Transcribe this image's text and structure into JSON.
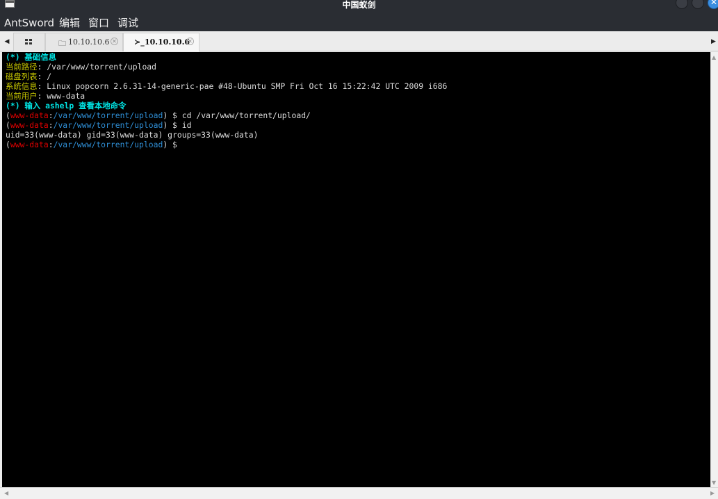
{
  "window": {
    "title": "中国蚁剑",
    "close_glyph": "✕"
  },
  "menu": {
    "items": [
      "AntSword",
      "编辑",
      "窗口",
      "调试"
    ]
  },
  "tabs": {
    "scroll_left": "◀",
    "scroll_right": "▶",
    "items": [
      {
        "icon": "folder-icon",
        "icon_glyph": "🗀",
        "label": "10.10.10.6",
        "close": "✕"
      },
      {
        "icon": "terminal-icon",
        "icon_glyph": "≻_",
        "label": "10.10.10.6",
        "close": "✕",
        "active": true
      }
    ]
  },
  "terminal": {
    "lines": [
      [
        {
          "t": "(*) 基础信息",
          "c": "cyan"
        }
      ],
      [
        {
          "t": "当前路径",
          "c": "olive"
        },
        {
          "t": ": /var/www/torrent/upload",
          "c": ""
        }
      ],
      [
        {
          "t": "磁盘列表",
          "c": "olive"
        },
        {
          "t": ": /",
          "c": ""
        }
      ],
      [
        {
          "t": "系统信息",
          "c": "olive"
        },
        {
          "t": ": Linux popcorn 2.6.31-14-generic-pae #48-Ubuntu SMP Fri Oct 16 15:22:42 UTC 2009 i686",
          "c": ""
        }
      ],
      [
        {
          "t": "当前用户",
          "c": "olive"
        },
        {
          "t": ": www-data",
          "c": ""
        }
      ],
      [
        {
          "t": "(*) 输入 ashelp 查看本地命令",
          "c": "cyan"
        }
      ],
      [
        {
          "t": "(",
          "c": ""
        },
        {
          "t": "www-data",
          "c": "red"
        },
        {
          "t": ":",
          "c": ""
        },
        {
          "t": "/var/www/torrent/upload",
          "c": "blue"
        },
        {
          "t": ") $ cd /var/www/torrent/upload/",
          "c": ""
        }
      ],
      [
        {
          "t": "(",
          "c": ""
        },
        {
          "t": "www-data",
          "c": "red"
        },
        {
          "t": ":",
          "c": ""
        },
        {
          "t": "/var/www/torrent/upload",
          "c": "blue"
        },
        {
          "t": ") $ id",
          "c": ""
        }
      ],
      [
        {
          "t": "uid=33(www-data) gid=33(www-data) groups=33(www-data)",
          "c": ""
        }
      ],
      [
        {
          "t": "(",
          "c": ""
        },
        {
          "t": "www-data",
          "c": "red"
        },
        {
          "t": ":",
          "c": ""
        },
        {
          "t": "/var/www/torrent/upload",
          "c": "blue"
        },
        {
          "t": ") $",
          "c": ""
        }
      ]
    ]
  },
  "scrollbars": {
    "up": "▲",
    "down": "▼",
    "left": "◀",
    "right": "▶"
  }
}
